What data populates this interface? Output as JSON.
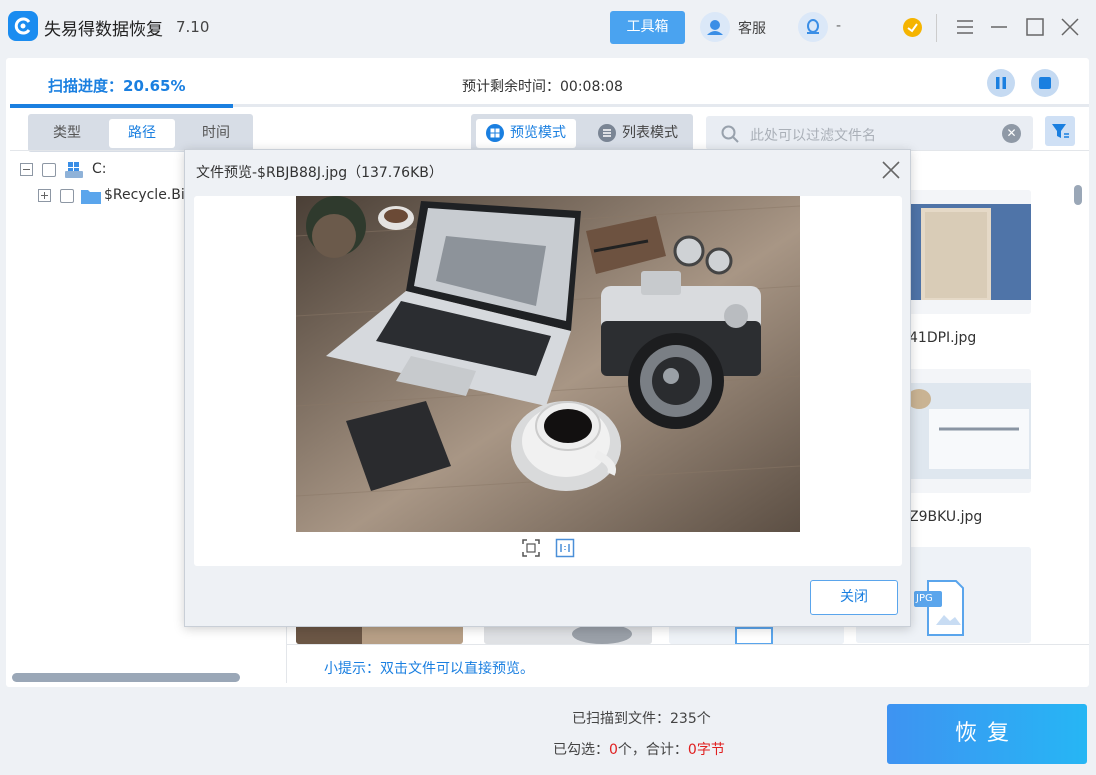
{
  "app": {
    "name": "失易得数据恢复",
    "version": "7.10",
    "toolbox_label": "工具箱",
    "service_label": "客服",
    "qq_label": "-"
  },
  "scan": {
    "progress_label": "扫描进度：20.65%",
    "progress_percent": 20.65,
    "remaining_label": "预计剩余时间：",
    "remaining_value": "00:08:08"
  },
  "tabs": [
    {
      "label": "类型",
      "active": false
    },
    {
      "label": "路径",
      "active": true
    },
    {
      "label": "时间",
      "active": false
    }
  ],
  "modes": [
    {
      "label": "预览模式",
      "active": true
    },
    {
      "label": "列表模式",
      "active": false
    }
  ],
  "search": {
    "placeholder": "此处可以过滤文件名",
    "clear_symbol": "✕"
  },
  "tree": [
    {
      "label": "C:",
      "expander": "−"
    },
    {
      "label": "$Recycle.Bi",
      "expander": "+"
    }
  ],
  "grid": {
    "labels": [
      "41DPI.jpg",
      "Z9BKU.jpg"
    ],
    "file_badge": "JPG"
  },
  "hint": "小提示：双击文件可以直接预览。",
  "dialog": {
    "title": "文件预览-$RBJB88J.jpg（137.76KB）",
    "close_label": "关闭"
  },
  "footer": {
    "scanned_label": "已扫描到文件：235个",
    "selected_prefix": "已勾选：",
    "selected_count": "0",
    "selected_mid": "个，合计：",
    "selected_size": "0字节",
    "recover_label": "恢复"
  },
  "colors": {
    "accent": "#1a7fe0",
    "recover_start": "#3e93f2",
    "recover_end": "#26b6f4",
    "warning": "#e02020"
  }
}
